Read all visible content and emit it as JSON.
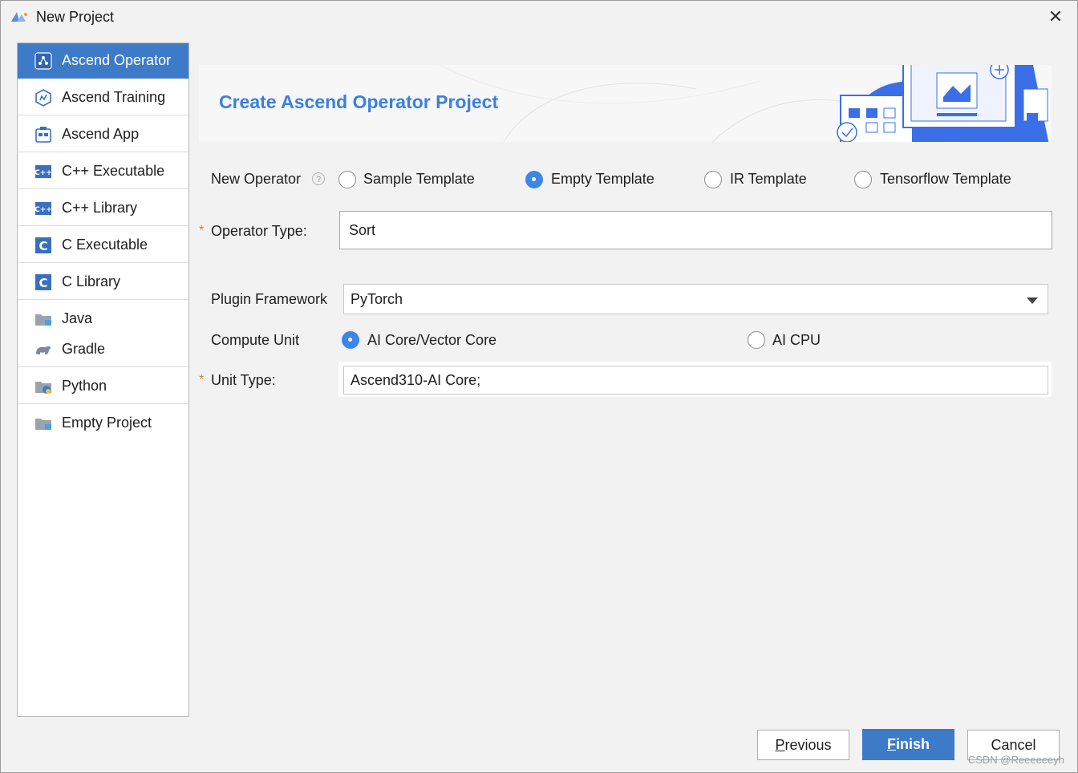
{
  "window": {
    "title": "New Project",
    "close_symbol": "✕"
  },
  "sidebar": {
    "items": [
      {
        "label": "Ascend Operator",
        "icon": "ascend-operator-icon",
        "active": true
      },
      {
        "label": "Ascend Training",
        "icon": "ascend-training-icon"
      },
      {
        "label": "Ascend App",
        "icon": "ascend-app-icon"
      },
      {
        "label": "C++ Executable",
        "icon": "cpp-icon",
        "badge": "C++"
      },
      {
        "label": "C++ Library",
        "icon": "cpp-icon",
        "badge": "C++"
      },
      {
        "label": "C Executable",
        "icon": "c-icon",
        "badge": "C"
      },
      {
        "label": "C Library",
        "icon": "c-icon",
        "badge": "C"
      },
      {
        "label": "Java",
        "icon": "folder-icon"
      },
      {
        "label": "Gradle",
        "icon": "gradle-icon"
      },
      {
        "label": "Python",
        "icon": "python-folder-icon"
      },
      {
        "label": "Empty Project",
        "icon": "empty-folder-icon"
      }
    ]
  },
  "banner": {
    "title": "Create Ascend Operator Project"
  },
  "form": {
    "new_operator": {
      "label": "New Operator",
      "help_symbol": "?",
      "options": [
        "Sample Template",
        "Empty Template",
        "IR Template",
        "Tensorflow Template"
      ],
      "selected": "Empty Template"
    },
    "operator_type": {
      "label": "Operator Type:",
      "required_mark": "*",
      "value": "Sort"
    },
    "plugin_framework": {
      "label": "Plugin Framework",
      "value": "PyTorch"
    },
    "compute_unit": {
      "label": "Compute Unit",
      "options": [
        "AI Core/Vector Core",
        "AI CPU"
      ],
      "selected": "AI Core/Vector Core"
    },
    "unit_type": {
      "label": "Unit Type:",
      "required_mark": "*",
      "value": "Ascend310-AI Core;"
    }
  },
  "buttons": {
    "previous": {
      "mnemonic": "P",
      "rest": "revious"
    },
    "finish": {
      "mnemonic": "F",
      "rest": "inish"
    },
    "cancel": "Cancel"
  },
  "watermark": "CSDN @Reeeeeeyh",
  "colors": {
    "accent": "#3d7bc8",
    "banner_title": "#3a7fe0",
    "required": "#e87a2c"
  }
}
